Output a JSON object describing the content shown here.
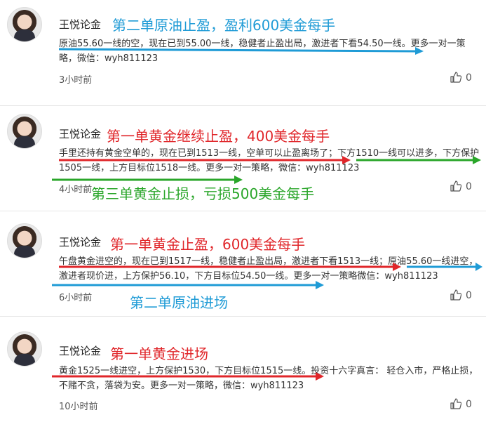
{
  "colors": {
    "blue": "#1f9bd6",
    "red": "#e0262a",
    "green": "#2aa62a"
  },
  "posts": [
    {
      "author": "王悦论金",
      "headline": "第二单原油止盈，盈利600美金每手",
      "body": "原油55.60一线的空，现在已到55.00一线，稳健者止盈出局，激进者下看54.50一线。更多一对一策略，微信：wyh811123",
      "time": "3小时前",
      "likes": "0"
    },
    {
      "author": "王悦论金",
      "headline": "第一单黄金继续止盈，400美金每手",
      "body": "手里还持有黄金空单的，现在已到1513一线，空单可以止盈离场了；下方1510一线可以进多，下方保护1505一线，上方目标位1518一线。更多一对一策略，微信：wyh811123",
      "time": "4小时前",
      "likes": "0",
      "annotation": "第三单黄金止损，亏损500美金每手"
    },
    {
      "author": "王悦论金",
      "headline": "第一单黄金止盈，600美金每手",
      "body": "午盘黄金进空的，现在已到1517一线，稳健者止盈出局，激进者下看1513一线；原油55.60一线进空，激进者现价进，上方保护56.10，下方目标位54.50一线。更多一对一策略微信：wyh811123",
      "time": "6小时前",
      "likes": "0",
      "annotation": "第二单原油进场"
    },
    {
      "author": "王悦论金",
      "headline": "第一单黄金进场",
      "body": "黄金1525一线进空，上方保护1530，下方目标位1515一线。投资十六字真言： 轻仓入市，严格止损，不赌不贪，落袋为安。更多一对一策略，微信：wyh811123",
      "time": "10小时前",
      "likes": "0"
    }
  ]
}
